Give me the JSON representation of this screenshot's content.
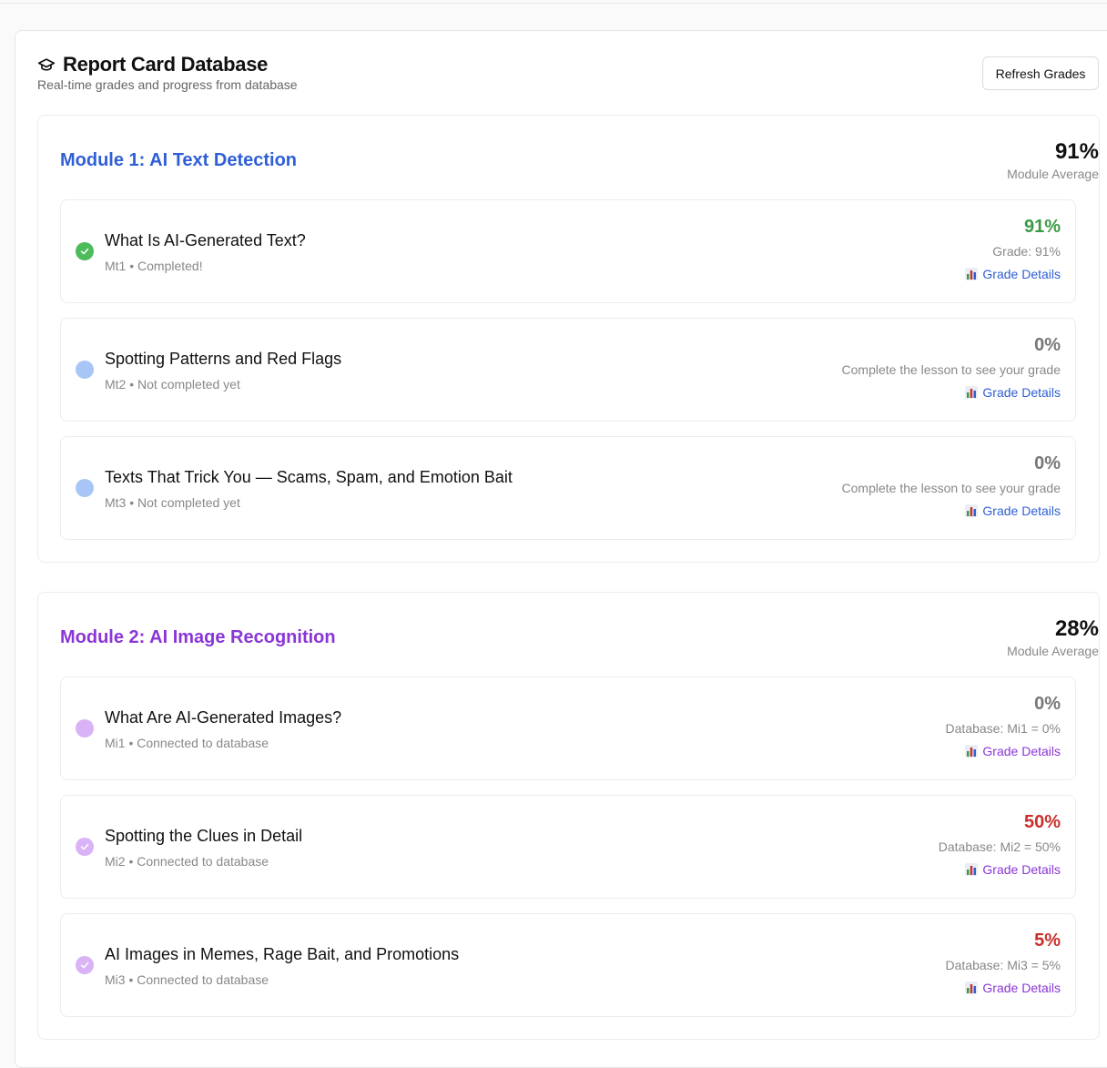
{
  "header": {
    "title": "Report Card Database",
    "subtitle": "Real-time grades and progress from database",
    "refresh_label": "Refresh Grades"
  },
  "modules": [
    {
      "title": "Module 1: AI Text Detection",
      "color": "#2f5fd6",
      "average": "91%",
      "average_label": "Module Average",
      "lessons": [
        {
          "title": "What Is AI-Generated Text?",
          "meta": "Mt1 • Completed!",
          "grade": "91%",
          "grade_color": "#3a9a44",
          "note": "Grade: 91%",
          "link": "Grade Details",
          "status": "completed"
        },
        {
          "title": "Spotting Patterns and Red Flags",
          "meta": "Mt2 • Not completed yet",
          "grade": "0%",
          "grade_color": "#777777",
          "note": "Complete the lesson to see your grade",
          "link": "Grade Details",
          "status": "pending"
        },
        {
          "title": "Texts That Trick You — Scams, Spam, and Emotion Bait",
          "meta": "Mt3 • Not completed yet",
          "grade": "0%",
          "grade_color": "#777777",
          "note": "Complete the lesson to see your grade",
          "link": "Grade Details",
          "status": "pending"
        }
      ]
    },
    {
      "title": "Module 2: AI Image Recognition",
      "color": "#8a35d8",
      "average": "28%",
      "average_label": "Module Average",
      "lessons": [
        {
          "title": "What Are AI-Generated Images?",
          "meta": "Mi1 • Connected to database",
          "grade": "0%",
          "grade_color": "#777777",
          "note": "Database: Mi1 = 0%",
          "link": "Grade Details",
          "status": "pending"
        },
        {
          "title": "Spotting the Clues in Detail",
          "meta": "Mi2 • Connected to database",
          "grade": "50%",
          "grade_color": "#c9302c",
          "note": "Database: Mi2 = 50%",
          "link": "Grade Details",
          "status": "checked"
        },
        {
          "title": "AI Images in Memes, Rage Bait, and Promotions",
          "meta": "Mi3 • Connected to database",
          "grade": "5%",
          "grade_color": "#c9302c",
          "note": "Database: Mi3 = 5%",
          "link": "Grade Details",
          "status": "checked"
        }
      ]
    }
  ]
}
